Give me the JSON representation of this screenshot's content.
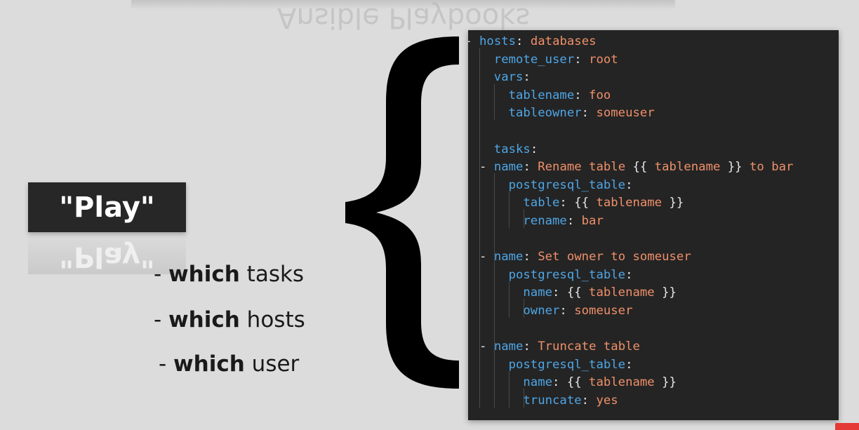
{
  "slide": {
    "title_reflection": "Ansible Playbooks",
    "play_label": "\"Play\"",
    "bullets": [
      {
        "prefix": "- ",
        "keyword": "which",
        "rest": " tasks"
      },
      {
        "prefix": "- ",
        "keyword": "which",
        "rest": " hosts"
      },
      {
        "prefix": "- ",
        "keyword": "which",
        "rest": " user"
      }
    ]
  },
  "colors": {
    "background": "#dcdcdc",
    "play_box": "#272727",
    "code_bg": "#242424",
    "key": "#4ea6e6",
    "value": "#f0906a",
    "punct": "#e6e6e6"
  },
  "code": {
    "lines": [
      {
        "indent": 0,
        "dash": true,
        "key": "hosts",
        "sep": ":",
        "value": "databases"
      },
      {
        "indent": 1,
        "dash": false,
        "key": "remote_user",
        "sep": ":",
        "value": "root"
      },
      {
        "indent": 1,
        "dash": false,
        "key": "vars",
        "sep": ":",
        "value": ""
      },
      {
        "indent": 2,
        "dash": false,
        "key": "tablename",
        "sep": ":",
        "value": "foo"
      },
      {
        "indent": 2,
        "dash": false,
        "key": "tableowner",
        "sep": ":",
        "value": "someuser"
      },
      {
        "indent": 0,
        "dash": false,
        "key": "",
        "sep": "",
        "value": ""
      },
      {
        "indent": 1,
        "dash": false,
        "key": "tasks",
        "sep": ":",
        "value": ""
      },
      {
        "indent": 1,
        "dash": true,
        "key": "name",
        "sep": ":",
        "value": "Rename table {{ tablename }} to bar"
      },
      {
        "indent": 2,
        "dash": false,
        "key": "postgresql_table",
        "sep": ":",
        "value": ""
      },
      {
        "indent": 3,
        "dash": false,
        "key": "table",
        "sep": ":",
        "value": "{{ tablename }}"
      },
      {
        "indent": 3,
        "dash": false,
        "key": "rename",
        "sep": ":",
        "value": "bar"
      },
      {
        "indent": 0,
        "dash": false,
        "key": "",
        "sep": "",
        "value": ""
      },
      {
        "indent": 1,
        "dash": true,
        "key": "name",
        "sep": ":",
        "value": "Set owner to someuser"
      },
      {
        "indent": 2,
        "dash": false,
        "key": "postgresql_table",
        "sep": ":",
        "value": ""
      },
      {
        "indent": 3,
        "dash": false,
        "key": "name",
        "sep": ":",
        "value": "{{ tablename }}"
      },
      {
        "indent": 3,
        "dash": false,
        "key": "owner",
        "sep": ":",
        "value": "someuser"
      },
      {
        "indent": 0,
        "dash": false,
        "key": "",
        "sep": "",
        "value": ""
      },
      {
        "indent": 1,
        "dash": true,
        "key": "name",
        "sep": ":",
        "value": "Truncate table"
      },
      {
        "indent": 2,
        "dash": false,
        "key": "postgresql_table",
        "sep": ":",
        "value": ""
      },
      {
        "indent": 3,
        "dash": false,
        "key": "name",
        "sep": ":",
        "value": "{{ tablename }}"
      },
      {
        "indent": 3,
        "dash": false,
        "key": "truncate",
        "sep": ":",
        "value": "yes"
      }
    ]
  }
}
